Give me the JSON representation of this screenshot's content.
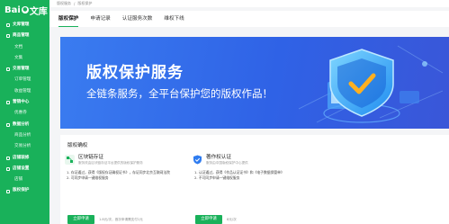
{
  "sidebar": {
    "logo_text": "Bai",
    "logo_suffix": "文库",
    "items": [
      {
        "label": "文库管理",
        "group": true
      },
      {
        "label": "商品管理",
        "group": true
      },
      {
        "label": "文档",
        "group": false
      },
      {
        "label": "文集",
        "group": false
      },
      {
        "label": "交易管理",
        "group": true
      },
      {
        "label": "订单管理",
        "group": false
      },
      {
        "label": "收益管理",
        "group": false
      },
      {
        "label": "营销中心",
        "group": true
      },
      {
        "label": "优惠券",
        "group": false
      },
      {
        "label": "数据分析",
        "group": true
      },
      {
        "label": "商品分析",
        "group": false
      },
      {
        "label": "交易分析",
        "group": false
      },
      {
        "label": "店铺装修",
        "group": true
      },
      {
        "label": "店铺设置",
        "group": true
      },
      {
        "label": "店铺",
        "group": false
      },
      {
        "label": "版权保护",
        "group": true
      }
    ]
  },
  "topbar": {
    "crumb1": "版权服务",
    "sep": "/",
    "crumb2": "版权保护"
  },
  "tabs": [
    "版权保护",
    "申请记录",
    "认证服务次数",
    "维权下线"
  ],
  "banner": {
    "title": "版权保护服务",
    "subtitle": "全链条服务，全平台保护您的版权作品！"
  },
  "panel": {
    "title": "版权确权",
    "cards": [
      {
        "name": "区块链存证",
        "desc": "服务改由区块链存证平台提供的版权保护服务",
        "line1": "1. 存证通过，获得《版权存证确权证书》，存证同步北京互联网法院",
        "line2": "2. 可同步申请一键维权服务",
        "button": "立即申请",
        "note": "1.8元/次，首次申请需支付1元"
      },
      {
        "name": "著作权认证",
        "desc": "服务由中国版权保护中心提供",
        "line1": "1. 认证通过，获得《作品认证证书》和《电子数据保管单》",
        "line2": "2. 不可同步申请一键维权服务",
        "button": "立即申请",
        "note": "8元/次"
      }
    ]
  },
  "colors": {
    "brand_green": "#19b15a",
    "banner_blue": "#2f62e6"
  }
}
